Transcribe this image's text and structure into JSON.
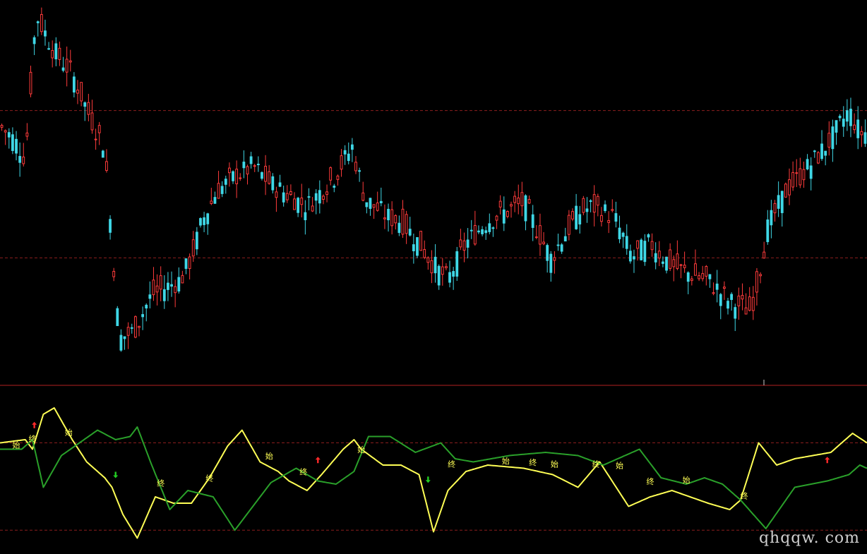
{
  "watermark": "qhqqw. com",
  "colors": {
    "background": "#000000",
    "up": "#ff3b3b",
    "down": "#3fd7e6",
    "grid": "#8b1e1e",
    "separator": "#b22222",
    "line1": "#ffff55",
    "line2": "#2aa02a",
    "label": "#ffff55",
    "arrow_up": "#ff2a2a",
    "arrow_down": "#22cc22"
  },
  "chart_data": [
    {
      "type": "candlestick",
      "title": "",
      "xlabel": "",
      "ylabel": "",
      "bars": 240,
      "ylim": [
        0,
        100
      ],
      "gridlines": [
        70,
        30
      ],
      "grid": "dashed",
      "trend_waypoints": [
        [
          0,
          66
        ],
        [
          8,
          62
        ],
        [
          14,
          57
        ],
        [
          20,
          96
        ],
        [
          30,
          86
        ],
        [
          40,
          80
        ],
        [
          50,
          68
        ],
        [
          58,
          60
        ],
        [
          66,
          8
        ],
        [
          74,
          10
        ],
        [
          84,
          20
        ],
        [
          92,
          22
        ],
        [
          100,
          24
        ],
        [
          106,
          30
        ],
        [
          112,
          40
        ],
        [
          120,
          48
        ],
        [
          130,
          52
        ],
        [
          140,
          55
        ],
        [
          150,
          50
        ],
        [
          170,
          44
        ],
        [
          185,
          52
        ],
        [
          195,
          60
        ],
        [
          202,
          46
        ],
        [
          215,
          41
        ],
        [
          222,
          40
        ],
        [
          232,
          34
        ],
        [
          240,
          28
        ],
        [
          248,
          24
        ],
        [
          258,
          34
        ],
        [
          270,
          40
        ],
        [
          290,
          45
        ],
        [
          305,
          30
        ],
        [
          320,
          42
        ],
        [
          328,
          44
        ],
        [
          340,
          41
        ],
        [
          350,
          30
        ],
        [
          360,
          34
        ],
        [
          372,
          28
        ],
        [
          380,
          26
        ],
        [
          392,
          24
        ],
        [
          404,
          18
        ],
        [
          415,
          16
        ],
        [
          418,
          20
        ],
        [
          425,
          38
        ],
        [
          435,
          48
        ],
        [
          450,
          56
        ],
        [
          460,
          62
        ],
        [
          470,
          70
        ],
        [
          476,
          64
        ]
      ]
    },
    {
      "type": "line",
      "title": "",
      "xlabel": "",
      "ylabel": "",
      "ylim": [
        0,
        100
      ],
      "gridlines": [
        70,
        15
      ],
      "grid": "dashed",
      "series": [
        {
          "color": "#ffff55",
          "points": [
            [
              0,
              70
            ],
            [
              14,
              72
            ],
            [
              18,
              66
            ],
            [
              24,
              88
            ],
            [
              30,
              92
            ],
            [
              40,
              72
            ],
            [
              48,
              58
            ],
            [
              58,
              48
            ],
            [
              62,
              42
            ],
            [
              68,
              25
            ],
            [
              76,
              10
            ],
            [
              86,
              36
            ],
            [
              96,
              32
            ],
            [
              106,
              32
            ],
            [
              116,
              48
            ],
            [
              126,
              68
            ],
            [
              134,
              78
            ],
            [
              144,
              58
            ],
            [
              154,
              52
            ],
            [
              160,
              46
            ],
            [
              170,
              40
            ],
            [
              178,
              50
            ],
            [
              190,
              66
            ],
            [
              196,
              72
            ],
            [
              200,
              66
            ],
            [
              212,
              56
            ],
            [
              222,
              56
            ],
            [
              232,
              50
            ],
            [
              240,
              14
            ],
            [
              248,
              40
            ],
            [
              258,
              52
            ],
            [
              270,
              56
            ],
            [
              290,
              54
            ],
            [
              306,
              50
            ],
            [
              320,
              42
            ],
            [
              332,
              58
            ],
            [
              348,
              30
            ],
            [
              360,
              36
            ],
            [
              372,
              40
            ],
            [
              392,
              32
            ],
            [
              404,
              28
            ],
            [
              410,
              34
            ],
            [
              420,
              70
            ],
            [
              430,
              56
            ],
            [
              440,
              60
            ],
            [
              460,
              64
            ],
            [
              472,
              76
            ],
            [
              480,
              70
            ]
          ]
        },
        {
          "color": "#2aa02a",
          "points": [
            [
              0,
              66
            ],
            [
              12,
              66
            ],
            [
              18,
              72
            ],
            [
              24,
              42
            ],
            [
              34,
              62
            ],
            [
              44,
              70
            ],
            [
              54,
              78
            ],
            [
              64,
              72
            ],
            [
              72,
              74
            ],
            [
              76,
              80
            ],
            [
              84,
              56
            ],
            [
              94,
              28
            ],
            [
              104,
              40
            ],
            [
              118,
              36
            ],
            [
              130,
              15
            ],
            [
              150,
              45
            ],
            [
              164,
              54
            ],
            [
              176,
              46
            ],
            [
              186,
              44
            ],
            [
              196,
              52
            ],
            [
              204,
              74
            ],
            [
              216,
              74
            ],
            [
              230,
              64
            ],
            [
              244,
              70
            ],
            [
              252,
              60
            ],
            [
              262,
              58
            ],
            [
              282,
              62
            ],
            [
              302,
              64
            ],
            [
              320,
              62
            ],
            [
              334,
              56
            ],
            [
              354,
              66
            ],
            [
              366,
              48
            ],
            [
              380,
              44
            ],
            [
              390,
              48
            ],
            [
              400,
              44
            ],
            [
              410,
              34
            ],
            [
              424,
              16
            ],
            [
              440,
              42
            ],
            [
              458,
              46
            ],
            [
              470,
              50
            ],
            [
              476,
              56
            ],
            [
              480,
              54
            ]
          ]
        }
      ],
      "annotations": [
        {
          "text": "始",
          "index": 9,
          "value": 67
        },
        {
          "text": "终",
          "index": 18,
          "value": 71
        },
        {
          "text": "始",
          "index": 38,
          "value": 75
        },
        {
          "text": "终",
          "index": 89,
          "value": 43
        },
        {
          "text": "终",
          "index": 116,
          "value": 46
        },
        {
          "text": "始",
          "index": 149,
          "value": 60
        },
        {
          "text": "终",
          "index": 168,
          "value": 50
        },
        {
          "text": "始",
          "index": 200,
          "value": 64
        },
        {
          "text": "终",
          "index": 250,
          "value": 55
        },
        {
          "text": "始",
          "index": 280,
          "value": 57
        },
        {
          "text": "终",
          "index": 295,
          "value": 56
        },
        {
          "text": "始",
          "index": 307,
          "value": 55
        },
        {
          "text": "终",
          "index": 330,
          "value": 55
        },
        {
          "text": "始",
          "index": 343,
          "value": 54
        },
        {
          "text": "终",
          "index": 360,
          "value": 44
        },
        {
          "text": "始",
          "index": 380,
          "value": 45
        },
        {
          "text": "终",
          "index": 412,
          "value": 35
        }
      ],
      "arrows": [
        {
          "dir": "up",
          "index": 19,
          "value": 81
        },
        {
          "dir": "down",
          "index": 64,
          "value": 50
        },
        {
          "dir": "up",
          "index": 176,
          "value": 59
        },
        {
          "dir": "down",
          "index": 237,
          "value": 47
        },
        {
          "dir": "up",
          "index": 458,
          "value": 59
        }
      ]
    }
  ]
}
